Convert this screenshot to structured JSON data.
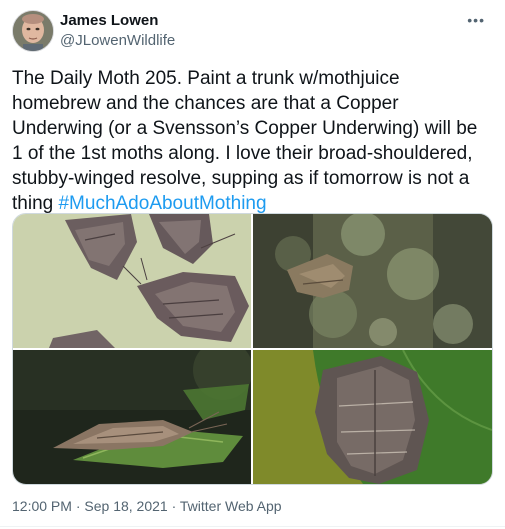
{
  "author": {
    "display_name": "James Lowen",
    "handle": "@JLowenWildlife",
    "avatar_icon": "user-avatar"
  },
  "more_icon": "more-options-icon",
  "tweet": {
    "body": "The Daily Moth 205. Paint a trunk w/mothjuice homebrew and the chances are that a Copper Underwing (or a Svensson’s Copper Underwing) will be 1 of the 1st moths along. I love their broad-shouldered, stubby-winged resolve, supping as if tomorrow is not a thing ",
    "hashtag": "#MuchAdoAboutMothing"
  },
  "media": [
    {
      "subject": "moth-photo-pale-background"
    },
    {
      "subject": "moth-photo-lichen-bark"
    },
    {
      "subject": "moth-photo-on-leaf"
    },
    {
      "subject": "moth-photo-green-leaf"
    }
  ],
  "footer": {
    "time": "12:00 PM",
    "separator1": " · ",
    "date": "Sep 18, 2021",
    "separator2": " · ",
    "source": "Twitter Web App"
  },
  "colors": {
    "text": "#0f1419",
    "secondary": "#536471",
    "link": "#1d9bf0",
    "border": "#cfd9de"
  }
}
